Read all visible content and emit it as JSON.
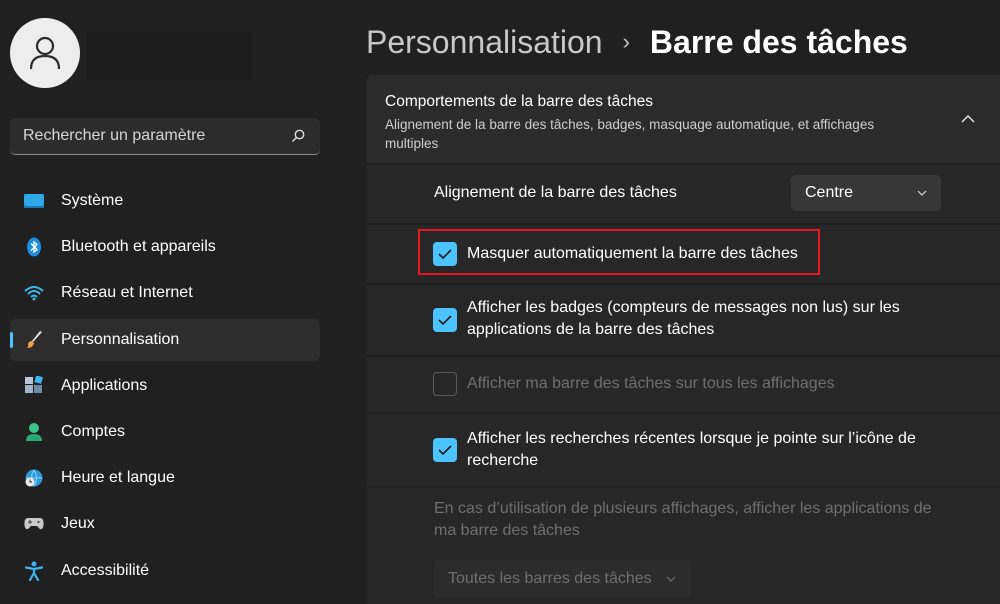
{
  "search": {
    "placeholder": "Rechercher un paramètre"
  },
  "sidebar": {
    "items": [
      {
        "label": "Système",
        "icon": "system-icon"
      },
      {
        "label": "Bluetooth et appareils",
        "icon": "bluetooth-icon"
      },
      {
        "label": "Réseau et Internet",
        "icon": "wifi-icon"
      },
      {
        "label": "Personnalisation",
        "icon": "brush-icon",
        "selected": true
      },
      {
        "label": "Applications",
        "icon": "apps-icon"
      },
      {
        "label": "Comptes",
        "icon": "person-icon"
      },
      {
        "label": "Heure et langue",
        "icon": "globe-clock-icon"
      },
      {
        "label": "Jeux",
        "icon": "gamepad-icon"
      },
      {
        "label": "Accessibilité",
        "icon": "accessibility-icon"
      }
    ]
  },
  "header": {
    "parent": "Personnalisation",
    "separator": "›",
    "current": "Barre des tâches"
  },
  "section": {
    "title": "Comportements de la barre des tâches",
    "description": "Alignement de la barre des tâches, badges, masquage automatique, et affichages multiples"
  },
  "alignment": {
    "label": "Alignement de la barre des tâches",
    "value": "Centre"
  },
  "options": {
    "autohide": {
      "label": "Masquer automatiquement la barre des tâches",
      "checked": true
    },
    "badges": {
      "label": "Afficher les badges (compteurs de messages non lus) sur les applications de la barre des tâches",
      "checked": true
    },
    "all_displays": {
      "label": "Afficher ma barre des tâches sur tous les affichages",
      "checked": false,
      "disabled": true
    },
    "recent_searches": {
      "label": "Afficher les recherches récentes lorsque je pointe sur l’icône de recherche",
      "checked": true
    }
  },
  "multi_display": {
    "text": "En cas d’utilisation de plusieurs affichages, afficher les applications de ma barre des tâches",
    "value": "Toutes les barres des tâches"
  },
  "colors": {
    "accent": "#4cc2ff",
    "highlight_border": "#e5191e",
    "background": "#202020",
    "card": "#2b2b2b"
  }
}
